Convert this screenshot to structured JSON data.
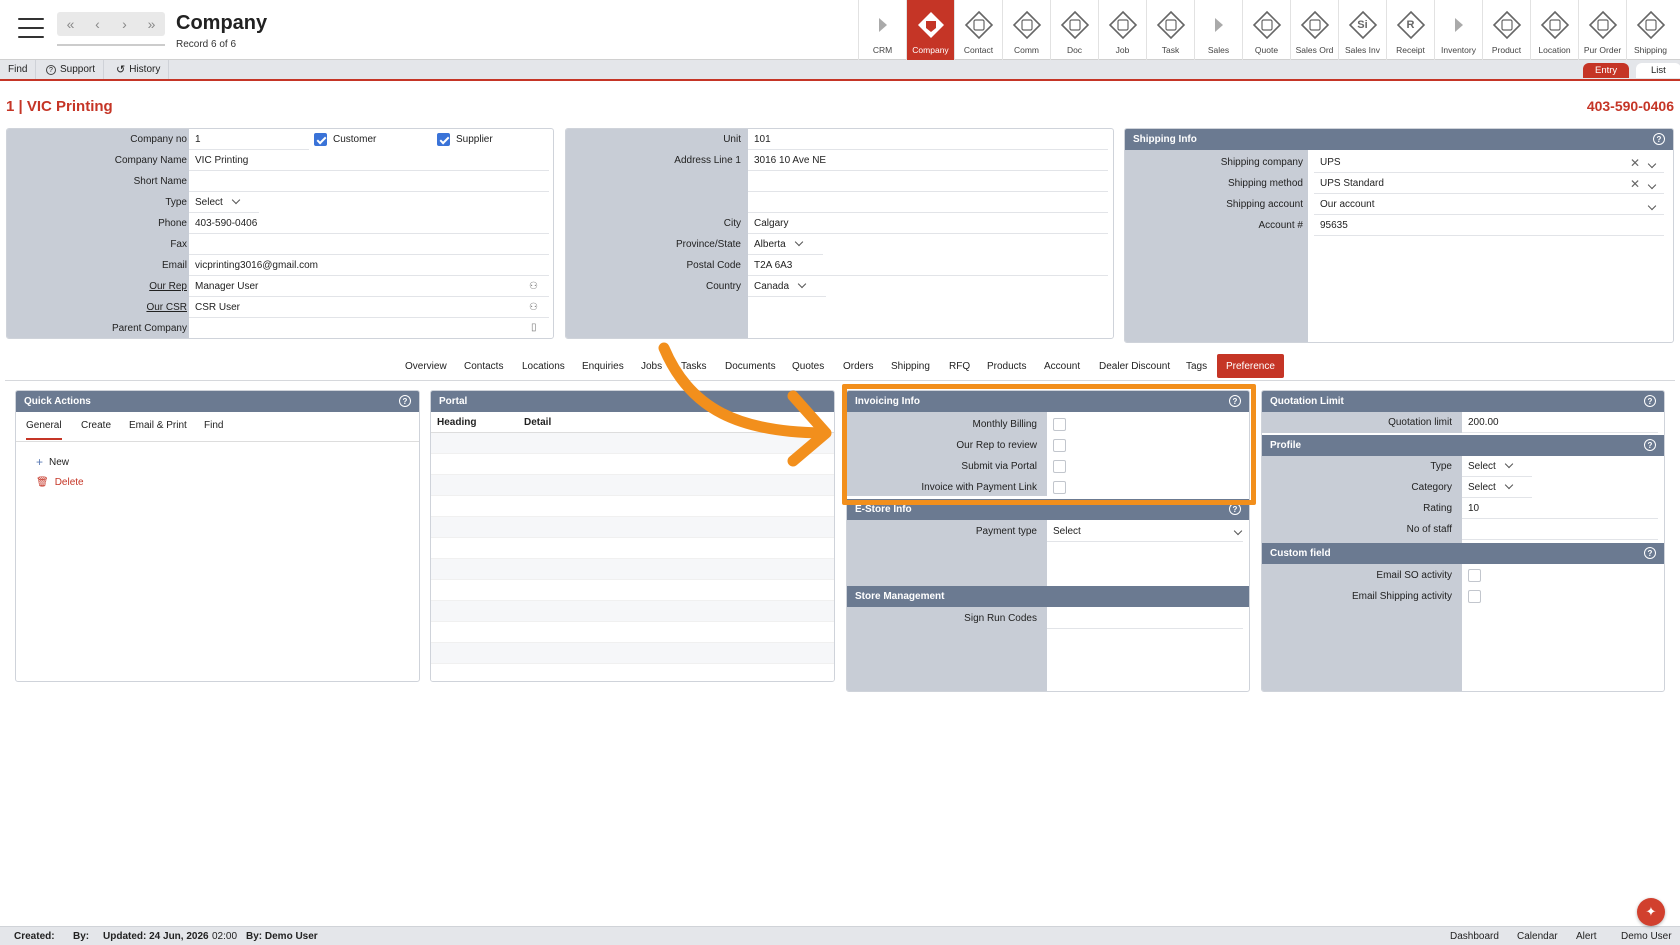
{
  "app": {
    "title": "Company",
    "record_info": "Record 6 of 6"
  },
  "modules": [
    {
      "label": "CRM",
      "icon": "chevron-right-icon",
      "arrow": true
    },
    {
      "label": "Company",
      "icon": "company-icon",
      "active": true
    },
    {
      "label": "Contact",
      "icon": "contact-icon"
    },
    {
      "label": "Comm",
      "icon": "comm-icon"
    },
    {
      "label": "Doc",
      "icon": "doc-icon"
    },
    {
      "label": "Job",
      "icon": "job-icon"
    },
    {
      "label": "Task",
      "icon": "task-icon"
    },
    {
      "label": "Sales",
      "icon": "chevron-right-icon",
      "arrow": true
    },
    {
      "label": "Quote",
      "icon": "quote-icon"
    },
    {
      "label": "Sales Ord",
      "icon": "sales-order-icon"
    },
    {
      "label": "Sales Inv",
      "icon": "sales-invoice-icon",
      "glyph": "Si"
    },
    {
      "label": "Receipt",
      "icon": "receipt-icon",
      "glyph": "R"
    },
    {
      "label": "Inventory",
      "icon": "chevron-right-icon",
      "arrow": true
    },
    {
      "label": "Product",
      "icon": "product-icon"
    },
    {
      "label": "Location",
      "icon": "location-icon"
    },
    {
      "label": "Pur Order",
      "icon": "cart-icon"
    },
    {
      "label": "Shipping",
      "icon": "truck-icon"
    }
  ],
  "toolbar": {
    "find": "Find",
    "support": "Support",
    "history": "History",
    "entry": "Entry",
    "list": "List"
  },
  "record": {
    "title": "1 | VIC Printing",
    "phone": "403-590-0406"
  },
  "company": {
    "company_no_label": "Company no",
    "company_no": "1",
    "customer_label": "Customer",
    "supplier_label": "Supplier",
    "name_label": "Company Name",
    "name": "VIC Printing",
    "short_name_label": "Short Name",
    "short_name": "",
    "type_label": "Type",
    "type": "Select",
    "phone_label": "Phone",
    "phone": "403-590-0406",
    "fax_label": "Fax",
    "fax": "",
    "email_label": "Email",
    "email": "vicprinting3016@gmail.com",
    "rep_label": "Our Rep",
    "rep": "Manager User",
    "csr_label": "Our CSR",
    "csr": "CSR User",
    "parent_label": "Parent Company",
    "parent": ""
  },
  "address": {
    "unit_label": "Unit",
    "unit": "101",
    "line1_label": "Address Line 1",
    "line1": "3016 10 Ave NE",
    "city_label": "City",
    "city": "Calgary",
    "province_label": "Province/State",
    "province": "Alberta",
    "postal_label": "Postal Code",
    "postal": "T2A 6A3",
    "country_label": "Country",
    "country": "Canada"
  },
  "shipping": {
    "title": "Shipping Info",
    "company_label": "Shipping company",
    "company": "UPS",
    "method_label": "Shipping method",
    "method": "UPS Standard",
    "account_label": "Shipping account",
    "account": "Our account",
    "account_no_label": "Account #",
    "account_no": "95635"
  },
  "tabs": [
    "Overview",
    "Contacts",
    "Locations",
    "Enquiries",
    "Jobs",
    "Tasks",
    "Documents",
    "Quotes",
    "Orders",
    "Shipping",
    "RFQ",
    "Products",
    "Account",
    "Dealer Discount",
    "Tags",
    "Preference"
  ],
  "quick_actions": {
    "title": "Quick Actions",
    "tabs": [
      "General",
      "Create",
      "Email & Print",
      "Find"
    ],
    "new": "New",
    "delete": "Delete"
  },
  "portal": {
    "title": "Portal",
    "heading": "Heading",
    "detail": "Detail"
  },
  "invoicing": {
    "title": "Invoicing Info",
    "monthly_billing": "Monthly Billing",
    "rep_review": "Our Rep to review",
    "submit_portal": "Submit via Portal",
    "payment_link": "Invoice with Payment Link"
  },
  "estore": {
    "title": "E-Store Info",
    "payment_type_label": "Payment type",
    "payment_type": "Select"
  },
  "store_mgmt": {
    "title": "Store Management",
    "sign_run_label": "Sign Run Codes"
  },
  "quotation": {
    "title": "Quotation Limit",
    "limit_label": "Quotation limit",
    "limit": "200.00"
  },
  "profile": {
    "title": "Profile",
    "type_label": "Type",
    "type": "Select",
    "category_label": "Category",
    "category": "Select",
    "rating_label": "Rating",
    "rating": "10",
    "staff_label": "No of staff",
    "staff": ""
  },
  "custom": {
    "title": "Custom field",
    "so_activity": "Email SO activity",
    "ship_activity": "Email Shipping activity"
  },
  "status": {
    "created": "Created:",
    "by1": "By:",
    "updated": "Updated: 24 Jun, 2026",
    "time": "02:00",
    "by2": "By: Demo User",
    "dashboard": "Dashboard",
    "calendar": "Calendar",
    "alert": "Alert",
    "user": "Demo User"
  },
  "colors": {
    "accent": "#c53526",
    "panel_header": "#6b7a91",
    "highlight": "#f28f1c"
  }
}
